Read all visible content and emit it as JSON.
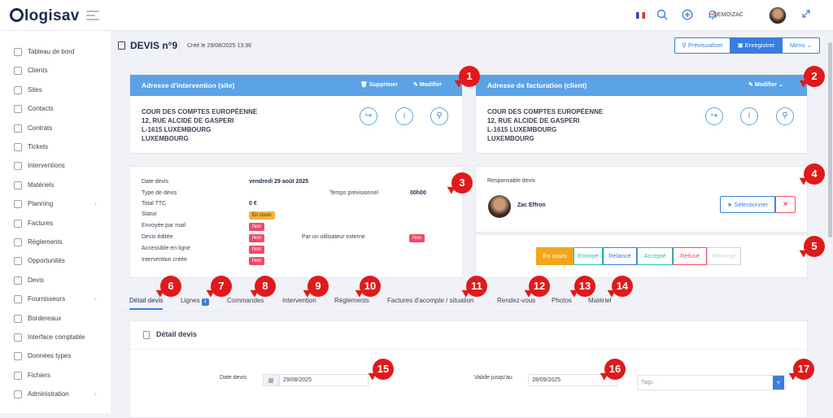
{
  "app": {
    "name": "logisav"
  },
  "topbar": {
    "user_label": "DEMO\\ZAC",
    "user_prefix": "↪",
    "flag": "fr-flag"
  },
  "sidebar": {
    "items": [
      {
        "label": "Tableau de bord",
        "icon": "dashboard-icon",
        "chevron": false
      },
      {
        "label": "Clients",
        "icon": "users-icon",
        "chevron": false
      },
      {
        "label": "Sites",
        "icon": "sites-icon",
        "chevron": false
      },
      {
        "label": "Contacts",
        "icon": "contacts-icon",
        "chevron": false
      },
      {
        "label": "Contrats",
        "icon": "contracts-icon",
        "chevron": false
      },
      {
        "label": "Tickets",
        "icon": "warning-icon",
        "chevron": false
      },
      {
        "label": "Interventions",
        "icon": "wrench-icon",
        "chevron": false
      },
      {
        "label": "Matériels",
        "icon": "cube-icon",
        "chevron": false
      },
      {
        "label": "Planning",
        "icon": "calendar-icon",
        "chevron": true
      },
      {
        "label": "Factures",
        "icon": "invoice-icon",
        "chevron": false
      },
      {
        "label": "Règlements",
        "icon": "payments-icon",
        "chevron": false
      },
      {
        "label": "Opportunités",
        "icon": "opportunity-icon",
        "chevron": false
      },
      {
        "label": "Devis",
        "icon": "quote-icon",
        "chevron": false
      },
      {
        "label": "Fournisseurs",
        "icon": "truck-icon",
        "chevron": true
      },
      {
        "label": "Bordereaux",
        "icon": "bordereau-icon",
        "chevron": false
      },
      {
        "label": "Interface comptable",
        "icon": "external-icon",
        "chevron": false
      },
      {
        "label": "Données types",
        "icon": "grid-icon",
        "chevron": false
      },
      {
        "label": "Fichiers",
        "icon": "file-icon",
        "chevron": false
      },
      {
        "label": "Administration",
        "icon": "admin-icon",
        "chevron": true
      }
    ],
    "chevron_glyph": "›"
  },
  "header": {
    "title": "DEVIS n°9",
    "created": "Créé le 29/08/2025 13:36",
    "preview": "Prévisualiser",
    "save": "Enregistrer",
    "menu": "Menu"
  },
  "addr_site": {
    "title": "Adresse d'intervention (site)",
    "delete": "Supprimer",
    "edit": "Modifier",
    "lines": [
      "COUR DES COMPTES EUROPÉENNE",
      "12, RUE ALCIDE DE GASPERI",
      "L-1615 LUXEMBOURG",
      "LUXEMBOURG"
    ]
  },
  "addr_bill": {
    "title": "Adresse de facturation (client)",
    "edit": "Modifier",
    "lines": [
      "COUR DES COMPTES EUROPÉENNE",
      "12, RUE ALCIDE DE GASPERI",
      "L-1615 LUXEMBOURG",
      "LUXEMBOURG"
    ]
  },
  "info": {
    "date_label": "Date devis",
    "date_value": "vendredi 29 août 2025",
    "type_label": "Type de devis",
    "temps_label": "Temps prévisionnel",
    "temps_value": "00h00",
    "ttc_label": "Total TTC",
    "ttc_value": "0 €",
    "statut_label": "Statut",
    "statut_value": "En cours",
    "mail_label": "Envoyée par mail",
    "mail_value": "Non",
    "edit_label": "Devis éditée",
    "edit_value": "Non",
    "ext_label": "Par un utilisateur externe",
    "ext_value": "Non",
    "online_label": "Accessible en ligne",
    "online_value": "Non",
    "interv_label": "Intervention créée",
    "interv_value": "Non"
  },
  "resp": {
    "label": "Responsable devis",
    "name": "Zac Effron",
    "select": "Sélectionner",
    "remove": "×"
  },
  "status_buttons": [
    {
      "label": "En cours",
      "color": "#f3a51b"
    },
    {
      "label": "Envoyé",
      "color": "#1bc5bd"
    },
    {
      "label": "Relancé",
      "color": "#3b7ddd"
    },
    {
      "label": "Accepté",
      "color": "#1bc5bd"
    },
    {
      "label": "Refusé",
      "color": "#f64e60"
    },
    {
      "label": "Renvoyé",
      "color": "#d0d3db"
    }
  ],
  "tabs": [
    {
      "label": "Détail devis",
      "count": ""
    },
    {
      "label": "Lignes",
      "count": "1"
    },
    {
      "label": "Commandes",
      "count": ""
    },
    {
      "label": "Intervention",
      "count": ""
    },
    {
      "label": "Règlements",
      "count": ""
    },
    {
      "label": "Factures d'acompte / situation",
      "count": ""
    },
    {
      "label": "Rendez-vous",
      "count": ""
    },
    {
      "label": "Photos",
      "count": ""
    },
    {
      "label": "Matériel",
      "count": ""
    }
  ],
  "detail": {
    "title": "Détail devis",
    "date_label": "Date devis",
    "date_value": "29/08/2025",
    "valid_label": "Valide jusqu'au",
    "valid_value": "28/09/2025",
    "tags_placeholder": "Tags"
  },
  "markers": [
    "1",
    "2",
    "3",
    "4",
    "5",
    "6",
    "7",
    "8",
    "9",
    "10",
    "11",
    "12",
    "13",
    "14",
    "15",
    "16",
    "17"
  ]
}
